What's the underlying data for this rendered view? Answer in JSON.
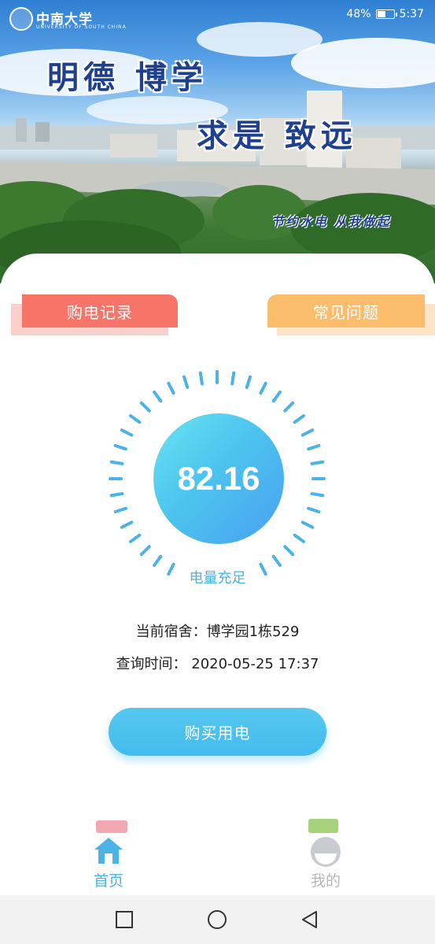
{
  "status_bar": {
    "battery": "48%",
    "time": "5:37",
    "battery_level": 0.48
  },
  "banner": {
    "university_name": "中南大学",
    "university_sub": "UNIVERSITY OF SOUTH CHINA",
    "motto_line1": "明德  博学",
    "motto_line2": "求是  致远",
    "slogan": "节约水电  从我做起"
  },
  "ribbons": {
    "left": "购电记录",
    "right": "常见问题"
  },
  "gauge": {
    "value": "82.16",
    "status": "电量充足",
    "accent": "#4bb3e6"
  },
  "info": {
    "dorm_label": "当前宿舍：",
    "dorm_value": "博学园1栋529",
    "time_label": "查询时间：",
    "time_value": "2020-05-25 17:37"
  },
  "buy_button": {
    "label": "购买用电"
  },
  "tabs": [
    {
      "label": "首页",
      "icon": "home-icon",
      "active": true
    },
    {
      "label": "我的",
      "icon": "profile-icon",
      "active": false
    }
  ],
  "nav": {
    "recent": "square-icon",
    "home": "circle-icon",
    "back": "triangle-back-icon"
  }
}
